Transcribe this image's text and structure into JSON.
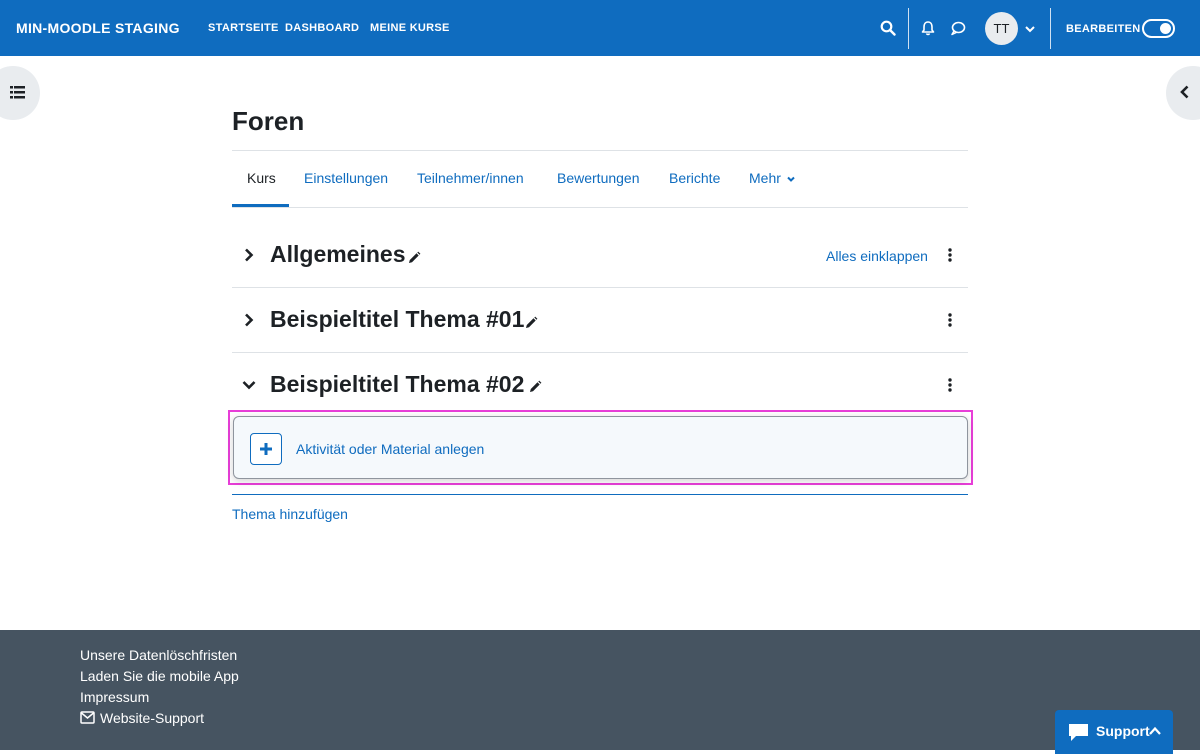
{
  "navbar": {
    "brand": "MIN-MOODLE STAGING",
    "links": [
      "STARTSEITE",
      "DASHBOARD",
      "MEINE KURSE"
    ],
    "avatar_initials": "TT",
    "edit_mode_label": "BEARBEITEN",
    "edit_mode_on": true,
    "icons": [
      "search-icon",
      "bell-icon",
      "message-icon",
      "chevron-down-icon"
    ]
  },
  "page": {
    "title": "Foren"
  },
  "tabs": [
    {
      "label": "Kurs",
      "active": true
    },
    {
      "label": "Einstellungen",
      "active": false
    },
    {
      "label": "Teilnehmer/innen",
      "active": false
    },
    {
      "label": "Bewertungen",
      "active": false
    },
    {
      "label": "Berichte",
      "active": false
    },
    {
      "label": "Mehr",
      "active": false
    }
  ],
  "course": {
    "collapse_all_label": "Alles einklappen",
    "sections": [
      {
        "title": "Allgemeines",
        "expanded": false
      },
      {
        "title": "Beispieltitel Thema #01",
        "expanded": false
      },
      {
        "title": "Beispieltitel Thema #02",
        "expanded": true
      }
    ],
    "add_activity_label": "Aktivität oder Material anlegen",
    "add_topic_label": "Thema hinzufügen"
  },
  "footer": {
    "links": [
      "Unsere Datenlöschfristen",
      "Laden Sie die mobile App",
      "Impressum",
      "Website-Support"
    ]
  },
  "support_button": {
    "label": "Support"
  },
  "colors": {
    "primary": "#0f6cbf",
    "footer_bg": "#465461",
    "highlight": "#e83ed8"
  }
}
